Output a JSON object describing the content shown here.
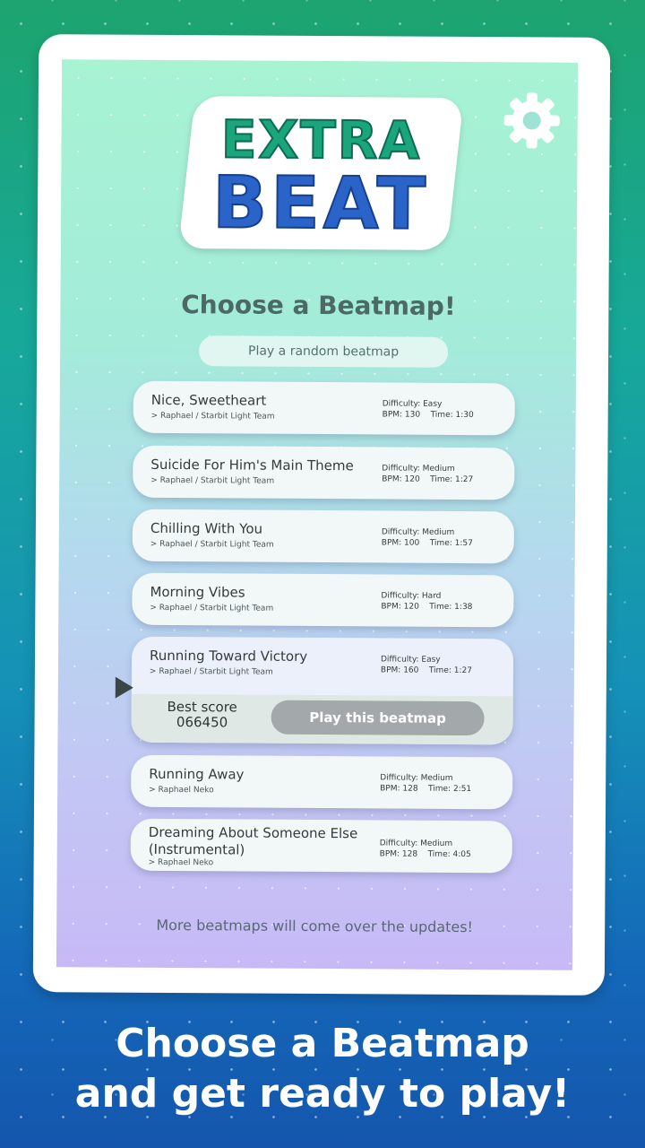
{
  "logo": {
    "line1": "EXTRA",
    "line2": "BEAT"
  },
  "icons": {
    "settings": "gear-icon",
    "selected": "play-arrow-icon"
  },
  "heading": "Choose a Beatmap!",
  "random_button": "Play a random beatmap",
  "beatmaps": [
    {
      "title": "Nice, Sweetheart",
      "artist": "> Raphael / Starbit Light Team",
      "difficulty": "Difficulty: Easy",
      "bpm": "BPM: 130",
      "time": "Time: 1:30"
    },
    {
      "title": "Suicide For Him's Main Theme",
      "artist": "> Raphael / Starbit Light Team",
      "difficulty": "Difficulty: Medium",
      "bpm": "BPM: 120",
      "time": "Time: 1:27"
    },
    {
      "title": "Chilling With You",
      "artist": "> Raphael / Starbit Light Team",
      "difficulty": "Difficulty: Medium",
      "bpm": "BPM: 100",
      "time": "Time: 1:57"
    },
    {
      "title": "Morning Vibes",
      "artist": "> Raphael / Starbit Light Team",
      "difficulty": "Difficulty: Hard",
      "bpm": "BPM: 120",
      "time": "Time: 1:38"
    },
    {
      "title": "Running Toward Victory",
      "artist": "> Raphael / Starbit Light Team",
      "difficulty": "Difficulty: Easy",
      "bpm": "BPM: 160",
      "time": "Time: 1:27"
    },
    {
      "title": "Running Away",
      "artist": "> Raphael Neko",
      "difficulty": "Difficulty: Medium",
      "bpm": "BPM: 128",
      "time": "Time: 2:51"
    },
    {
      "title": "Dreaming About Someone Else",
      "title2": "(Instrumental)",
      "artist": "> Raphael Neko",
      "difficulty": "Difficulty: Medium",
      "bpm": "BPM: 128",
      "time": "Time: 4:05"
    }
  ],
  "selected": {
    "best_label": "Best score",
    "best_value": "066450",
    "play_label": "Play this beatmap"
  },
  "footer_note": "More beatmaps will come over the updates!",
  "caption": {
    "line1": "Choose a Beatmap",
    "line2": "and get ready to play!"
  }
}
